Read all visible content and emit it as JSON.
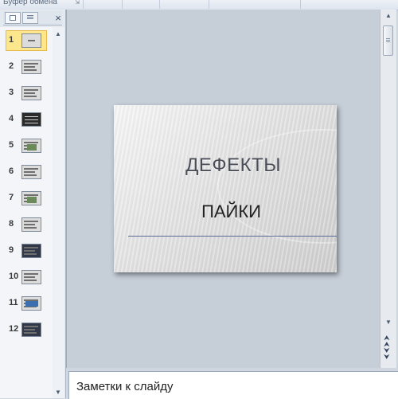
{
  "ribbon": {
    "group_label": "Буфер обмена"
  },
  "pane": {
    "tabs": [
      {
        "id": "slides",
        "icon": "slides-tab-icon"
      },
      {
        "id": "outline",
        "icon": "outline-tab-icon"
      }
    ],
    "close_glyph": "×",
    "selected_slide": 1,
    "thumbnails": [
      {
        "num": "1"
      },
      {
        "num": "2"
      },
      {
        "num": "3"
      },
      {
        "num": "4"
      },
      {
        "num": "5"
      },
      {
        "num": "6"
      },
      {
        "num": "7"
      },
      {
        "num": "8"
      },
      {
        "num": "9"
      },
      {
        "num": "10"
      },
      {
        "num": "11"
      },
      {
        "num": "12"
      }
    ]
  },
  "slide": {
    "title": "ДЕФЕКТЫ",
    "subtitle": "ПАЙКИ"
  },
  "notes": {
    "placeholder": "Заметки к слайду"
  },
  "colors": {
    "selection_fill": "#fde78c",
    "selection_border": "#e8b84a",
    "workspace": "#c6ced8",
    "title_text": "#4a4d57",
    "rule": "#5c6a95"
  }
}
